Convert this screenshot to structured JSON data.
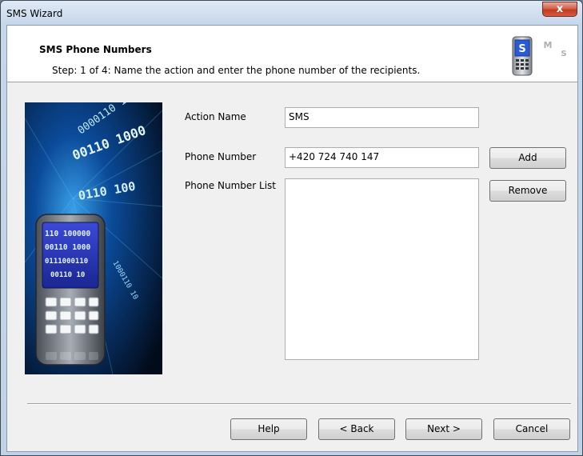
{
  "window": {
    "title": "SMS Wizard",
    "close_glyph": "x"
  },
  "header": {
    "title": "SMS Phone Numbers",
    "subtitle": "Step: 1 of 4: Name the action and enter the phone number of the recipients.",
    "logo_icon": "sms-phone-logo-icon",
    "logo_letters": [
      "S",
      "M",
      "S"
    ]
  },
  "side_image": {
    "icon": "phone-binary-illustration",
    "screen_lines": [
      "110 100000",
      "00110 1000",
      "0111000110",
      "00110 10"
    ],
    "background_text": [
      "0000110 10",
      "00110 1000",
      "0110 100",
      "1000110 10"
    ]
  },
  "form": {
    "action_name_label": "Action Name",
    "action_name_value": "SMS",
    "phone_number_label": "Phone Number",
    "phone_number_value": "+420 724 740 147",
    "phone_list_label": "Phone Number List",
    "phone_list_items": [],
    "add_label": "Add",
    "remove_label": "Remove"
  },
  "footer": {
    "help_label": "Help",
    "back_label": "< Back",
    "next_label": "Next >",
    "cancel_label": "Cancel"
  },
  "colors": {
    "title_bar": "#c6d7ea",
    "close_button": "#c7432a",
    "dialog_bg": "#f0f0f0",
    "header_bg": "#ffffff",
    "image_blue": "#0a3a7a"
  }
}
